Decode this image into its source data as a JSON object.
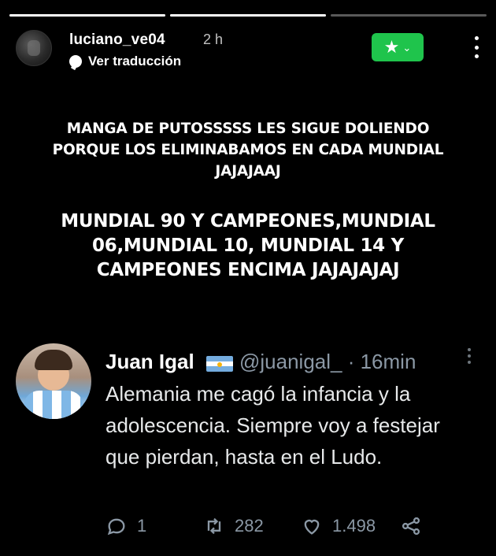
{
  "story": {
    "progress": [
      1.0,
      1.0,
      0.0
    ],
    "username": "luciano_ve04",
    "time": "2 h",
    "translate_label": "Ver traducción",
    "close_friends_color": "#1fc44c",
    "caption_1": "MANGA DE PUTOSSSSS LES SIGUE DOLIENDO PORQUE LOS ELIMINABAMOS EN CADA MUNDIAL JAJAJAAJ",
    "caption_2": "MUNDIAL 90 Y CAMPEONES,MUNDIAL 06,MUNDIAL 10, MUNDIAL 14 Y CAMPEONES ENCIMA JAJAJAJAJ"
  },
  "tweet": {
    "name": "Juan Igal",
    "flag_icon": "argentina-flag-icon",
    "handle_time": "@juanigal_ · 16min",
    "text": "Alemania me cagó la infancia y la adolescencia. Siempre voy a festejar que pierdan, hasta en el Ludo.",
    "replies": "1",
    "retweets": "282",
    "likes": "1.498",
    "icons": [
      "reply-icon",
      "retweet-icon",
      "heart-icon",
      "share-icon"
    ]
  }
}
